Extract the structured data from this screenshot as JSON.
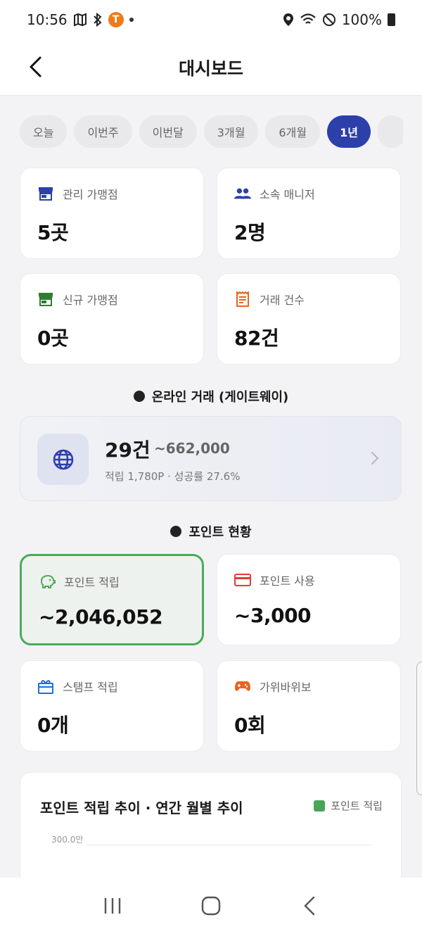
{
  "status_bar": {
    "time": "10:56",
    "badge": "T",
    "battery": "100%"
  },
  "header": {
    "title": "대시보드",
    "back_icon": "chevron-left-icon"
  },
  "period_tabs": [
    {
      "label": "오늘",
      "active": false
    },
    {
      "label": "이번주",
      "active": false
    },
    {
      "label": "이번달",
      "active": false
    },
    {
      "label": "3개월",
      "active": false
    },
    {
      "label": "6개월",
      "active": false
    },
    {
      "label": "1년",
      "active": true
    }
  ],
  "summary": {
    "stores": {
      "label": "관리 가맹점",
      "value": "5곳",
      "icon": "store-icon",
      "color": "#2d3fa9"
    },
    "managers": {
      "label": "소속 매니저",
      "value": "2명",
      "icon": "people-icon",
      "color": "#2d3fa9"
    },
    "new_stores": {
      "label": "신규 가맹점",
      "value": "0곳",
      "icon": "store-icon",
      "color": "#2e7d32"
    },
    "transactions": {
      "label": "거래 건수",
      "value": "82건",
      "icon": "receipt-icon",
      "color": "#e8651e"
    }
  },
  "online_section": {
    "title": "온라인 거래 (게이트웨이)",
    "count": "29건",
    "amount": "~662,000",
    "sub": "적립 1,780P · 성공률 27.6%"
  },
  "points_section": {
    "title": "포인트 현황",
    "earned": {
      "label": "포인트 적립",
      "value": "~2,046,052",
      "icon": "piggy-bank-icon",
      "color": "#4aab57"
    },
    "used": {
      "label": "포인트 사용",
      "value": "~3,000",
      "icon": "credit-card-icon",
      "color": "#e23b3b"
    },
    "stamps": {
      "label": "스탬프 적립",
      "value": "0개",
      "icon": "gift-icon",
      "color": "#1e6fd9"
    },
    "rps": {
      "label": "가위바위보",
      "value": "0회",
      "icon": "gamepad-icon",
      "color": "#e8651e"
    }
  },
  "chart": {
    "title": "포인트 적립 추이 · 연간 월별 추이",
    "legend": "포인트 적립",
    "legend_color": "#49a55a",
    "y_tick": "300.0만"
  }
}
